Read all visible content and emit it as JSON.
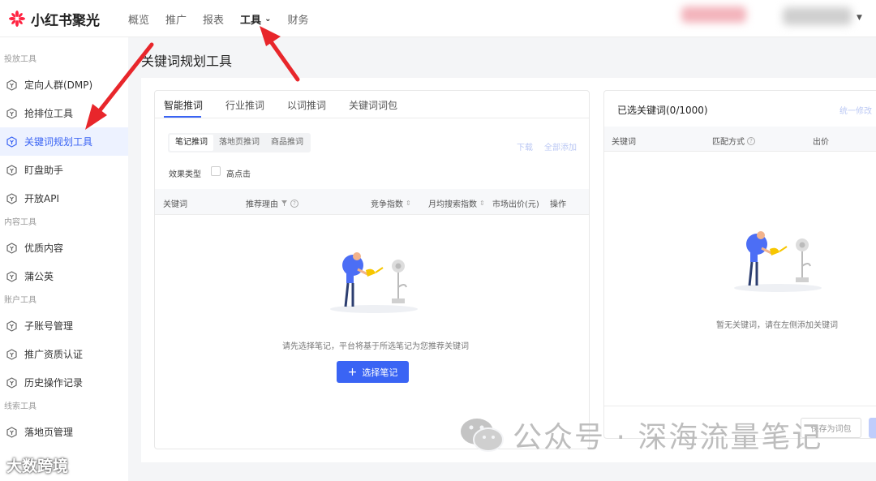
{
  "brand": {
    "name": "小红书聚光"
  },
  "nav": {
    "items": [
      "概览",
      "推广",
      "报表",
      "工具",
      "财务"
    ],
    "active": "工具"
  },
  "sidebar": {
    "groups": [
      {
        "title": "投放工具",
        "items": [
          "定向人群(DMP)",
          "抢排位工具",
          "关键词规划工具",
          "盯盘助手",
          "开放API"
        ]
      },
      {
        "title": "内容工具",
        "items": [
          "优质内容",
          "蒲公英"
        ]
      },
      {
        "title": "账户工具",
        "items": [
          "子账号管理",
          "推广资质认证",
          "历史操作记录"
        ]
      },
      {
        "title": "线索工具",
        "items": [
          "落地页管理"
        ]
      }
    ],
    "active": "关键词规划工具"
  },
  "page": {
    "title": "关键词规划工具"
  },
  "left": {
    "tabs": [
      "智能推词",
      "行业推词",
      "以词推词",
      "关键词词包"
    ],
    "subtabs": [
      "笔记推词",
      "落地页推词",
      "商品推词"
    ],
    "download": "下载",
    "add_all": "全部添加",
    "effect_label": "效果类型",
    "effect_option": "高点击",
    "columns": [
      "关键词",
      "推荐理由",
      "竞争指数",
      "月均搜索指数",
      "市场出价(元)",
      "操作"
    ],
    "empty_text": "请先选择笔记，平台将基于所选笔记为您推荐关键词",
    "select_button": "选择笔记"
  },
  "right": {
    "title": "已选关键词(0/1000)",
    "batch_edit": "统一修改",
    "columns": [
      "关键词",
      "匹配方式",
      "出价"
    ],
    "empty_text": "暂无关键词，请在左侧添加关键词",
    "save_button": "保存为词包"
  },
  "watermark": {
    "text": "公众号 · 深海流量笔记",
    "text2": "大数跨境"
  },
  "colors": {
    "primary": "#3a64f4",
    "brand": "#ff2442",
    "annotation_arrow": "#e8262b"
  }
}
